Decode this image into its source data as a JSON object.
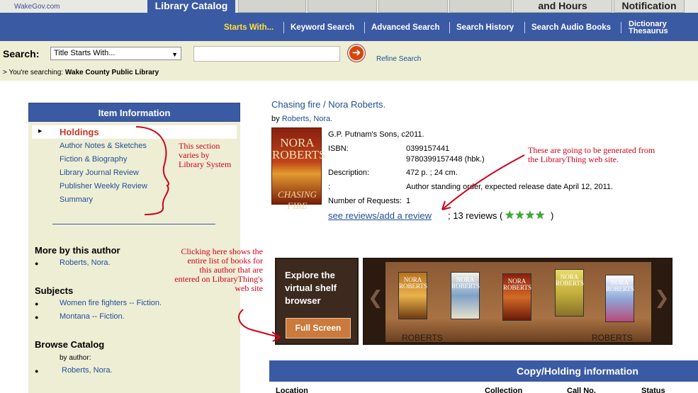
{
  "top_tabs": {
    "logo_text": "WakeGov.com",
    "library_catalog": "Library Catalog",
    "hours": "and Hours",
    "notification": "Notification"
  },
  "nav": {
    "starts_with": "Starts With...",
    "keyword_search": "Keyword Search",
    "advanced_search": "Advanced Search",
    "search_history": "Search History",
    "search_audio_books": "Search Audio Books",
    "dictionary_line1": "Dictionary",
    "dictionary_line2": "Thesaurus"
  },
  "search": {
    "label": "Search:",
    "select_value": "Title Starts With...",
    "input_value": "",
    "refine_label": "Refine Search",
    "searching_prefix": "> You're searching:",
    "searching_library": "Wake County Public Library"
  },
  "item_info": {
    "header": "Item Information",
    "holdings_label": "Holdings",
    "links": [
      "Author Notes & Sketches",
      "Fiction & Biography",
      "Library Journal Review",
      "Publisher Weekly Review",
      "Summary"
    ],
    "more_by_author_title": "More by this author",
    "more_by_author_items": [
      "Roberts, Nora."
    ],
    "subjects_title": "Subjects",
    "subjects_items": [
      "Women fire fighters -- Fiction.",
      "Montana -- Fiction."
    ],
    "browse_title": "Browse Catalog",
    "browse_by": "by author:",
    "browse_items": [
      "Roberts, Nora."
    ]
  },
  "record": {
    "title": "Chasing fire / Nora Roberts.",
    "by_label": "by",
    "author": "Roberts, Nora.",
    "cover_author": "NORA ROBERTS",
    "cover_title": "CHASING FIRE",
    "publisher": "G.P. Putnam's Sons, c2011.",
    "isbn_label": "ISBN:",
    "isbn_1": "0399157441",
    "isbn_2": "9780399157448 (hbk.)",
    "description_label": "Description:",
    "description_value": "472 p. ; 24 cm.",
    "note_label": ":",
    "note_value": "Author standing order, expected release date April 12, 2011.",
    "requests_label": "Number of Requests:",
    "requests_value": "1",
    "reviews_link": "see reviews/add a review",
    "reviews_count": "; 13 reviews (",
    "stars": "★★★★",
    "stars_close": ")"
  },
  "shelf": {
    "explore_text": "Explore the virtual shelf browser",
    "fullscreen_label": "Full Screen",
    "left_label": "ROBERTS",
    "right_label": "ROBERTS",
    "book_labels": [
      "NORA ROBERTS",
      "NORA ROBERTS",
      "NORA ROBERTS",
      "NORA ROBERTS",
      "NORA ROBERTS"
    ]
  },
  "copy": {
    "header": "Copy/Holding information",
    "columns": [
      "Location",
      "Collection",
      "Call No.",
      "Status"
    ]
  },
  "annotations": {
    "section_note": "This section varies by Library System",
    "generated_note": "These are going to be generated from the LibraryThing web site.",
    "click_note": "Clicking here shows the entire list of books for this author that are entered on LibraryThing's web site"
  }
}
